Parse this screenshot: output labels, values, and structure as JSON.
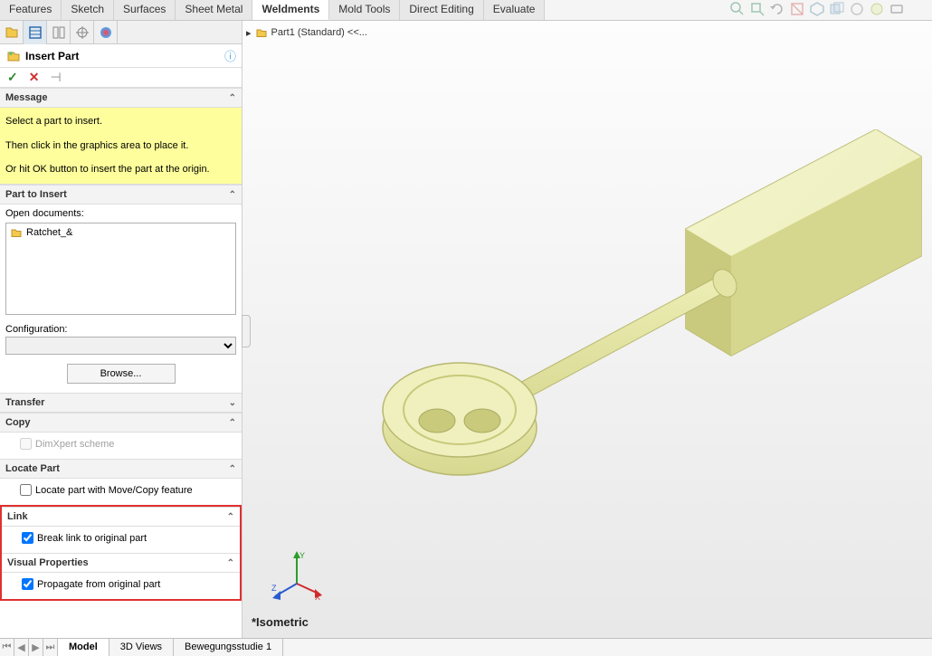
{
  "ribbon": {
    "tabs": [
      "Features",
      "Sketch",
      "Surfaces",
      "Sheet Metal",
      "Weldments",
      "Mold Tools",
      "Direct Editing",
      "Evaluate"
    ],
    "active": 4
  },
  "breadcrumb": {
    "part": "Part1 (Standard) <<..."
  },
  "pm": {
    "title": "Insert Part",
    "ok": "✓",
    "cancel": "✕",
    "pin": "⊣"
  },
  "message": {
    "header": "Message",
    "line1": "Select a part to insert.",
    "line2": "Then click in the graphics area to place it.",
    "line3": "Or hit OK button to insert the part at the origin."
  },
  "partToInsert": {
    "header": "Part to Insert",
    "openDocsLabel": "Open documents:",
    "items": [
      "Ratchet_&"
    ],
    "configLabel": "Configuration:",
    "configValue": "",
    "browse": "Browse..."
  },
  "transfer": {
    "header": "Transfer"
  },
  "copy": {
    "header": "Copy",
    "dimxpert": "DimXpert scheme"
  },
  "locate": {
    "header": "Locate Part",
    "opt": "Locate part with Move/Copy feature"
  },
  "link": {
    "header": "Link",
    "opt": "Break link to original part"
  },
  "visprops": {
    "header": "Visual Properties",
    "opt": "Propagate from original part"
  },
  "viewport": {
    "viewLabel": "*Isometric"
  },
  "bottom": {
    "tabs": [
      "Model",
      "3D Views",
      "Bewegungsstudie 1"
    ],
    "active": 0
  }
}
